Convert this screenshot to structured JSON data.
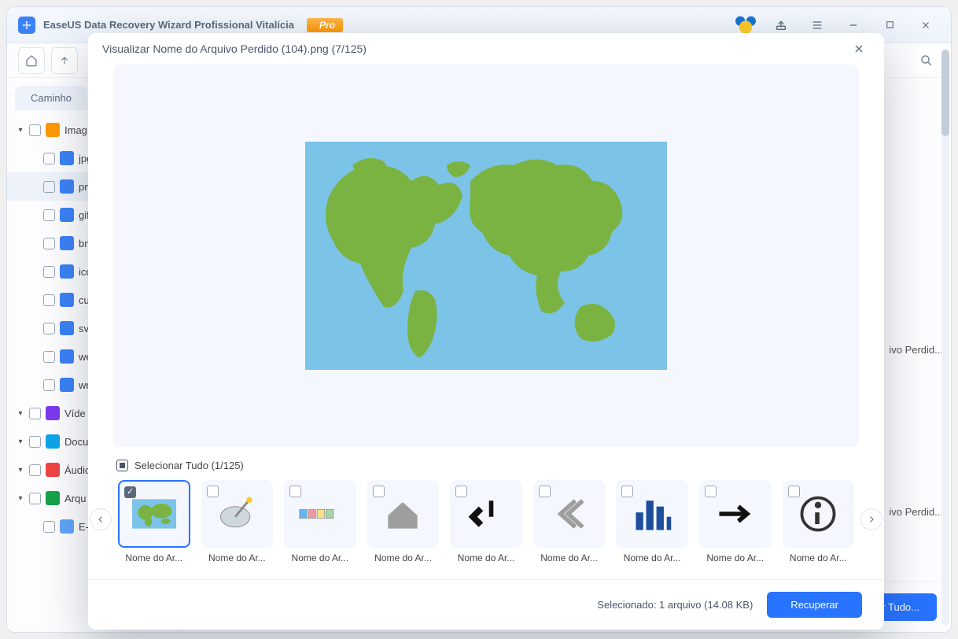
{
  "app": {
    "title": "EaseUS Data Recovery Wizard Profissional Vitalícia",
    "pro_label": "Pro"
  },
  "sidebar": {
    "path_tab": "Caminho",
    "items": [
      {
        "label": "Imag",
        "kind": "img",
        "caret": true
      },
      {
        "label": "jpg",
        "kind": "folder",
        "indent": true
      },
      {
        "label": "png",
        "kind": "folder",
        "indent": true,
        "selected": true
      },
      {
        "label": "gif",
        "kind": "folder",
        "indent": true
      },
      {
        "label": "bmp",
        "kind": "folder",
        "indent": true
      },
      {
        "label": "ico",
        "kind": "folder",
        "indent": true
      },
      {
        "label": "cur",
        "kind": "folder",
        "indent": true
      },
      {
        "label": "svg",
        "kind": "folder",
        "indent": true
      },
      {
        "label": "web",
        "kind": "folder",
        "indent": true
      },
      {
        "label": "wm",
        "kind": "folder",
        "indent": true
      },
      {
        "label": "Víde",
        "kind": "video",
        "caret": true
      },
      {
        "label": "Docu",
        "kind": "doc",
        "caret": true
      },
      {
        "label": "Áudio",
        "kind": "audio",
        "caret": true
      },
      {
        "label": "Arqu",
        "kind": "arch",
        "caret": true
      },
      {
        "label": "E-ma",
        "kind": "mail",
        "indent": true
      }
    ]
  },
  "bottom": {
    "recover_all": "Recuperar Tudo..."
  },
  "grid_labels": [
    "ivo Perdid...",
    "ivo Perdid..."
  ],
  "modal": {
    "title": "Visualizar Nome do Arquivo Perdido (104).png (7/125)",
    "select_all": "Selecionar Tudo (1/125)",
    "footer_info": "Selecionado: 1 arquivo (14.08 KB)",
    "recover": "Recuperar",
    "thumbs": [
      {
        "label": "Nome do Ar...",
        "icon": "world",
        "selected": true
      },
      {
        "label": "Nome do Ar...",
        "icon": "dish"
      },
      {
        "label": "Nome do Ar...",
        "icon": "boxes"
      },
      {
        "label": "Nome do Ar...",
        "icon": "home"
      },
      {
        "label": "Nome do Ar...",
        "icon": "return"
      },
      {
        "label": "Nome do Ar...",
        "icon": "chev"
      },
      {
        "label": "Nome do Ar...",
        "icon": "bars"
      },
      {
        "label": "Nome do Ar...",
        "icon": "arrow"
      },
      {
        "label": "Nome do Ar...",
        "icon": "info"
      }
    ]
  }
}
